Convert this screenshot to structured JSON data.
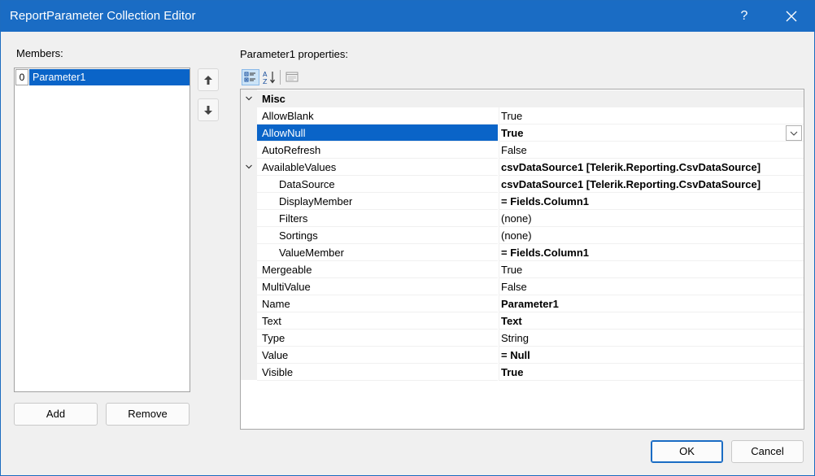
{
  "window": {
    "title": "ReportParameter Collection Editor",
    "help_label": "?"
  },
  "members": {
    "label": "Members:",
    "items": [
      {
        "index": "0",
        "name": "Parameter1"
      }
    ],
    "add_label": "Add",
    "remove_label": "Remove"
  },
  "properties": {
    "label": "Parameter1 properties:",
    "category": "Misc",
    "rows": [
      {
        "name": "AllowBlank",
        "value": "True",
        "bold": false,
        "indent": 0,
        "selected": false
      },
      {
        "name": "AllowNull",
        "value": "True",
        "bold": true,
        "indent": 0,
        "selected": true
      },
      {
        "name": "AutoRefresh",
        "value": "False",
        "bold": false,
        "indent": 0,
        "selected": false
      },
      {
        "name": "AvailableValues",
        "value": "csvDataSource1 [Telerik.Reporting.CsvDataSource]",
        "bold": true,
        "indent": 0,
        "selected": false,
        "expandable": true
      },
      {
        "name": "DataSource",
        "value": "csvDataSource1 [Telerik.Reporting.CsvDataSource]",
        "bold": true,
        "indent": 1,
        "selected": false
      },
      {
        "name": "DisplayMember",
        "value": "= Fields.Column1",
        "bold": true,
        "indent": 1,
        "selected": false
      },
      {
        "name": "Filters",
        "value": "(none)",
        "bold": false,
        "indent": 1,
        "selected": false
      },
      {
        "name": "Sortings",
        "value": "(none)",
        "bold": false,
        "indent": 1,
        "selected": false
      },
      {
        "name": "ValueMember",
        "value": "= Fields.Column1",
        "bold": true,
        "indent": 1,
        "selected": false
      },
      {
        "name": "Mergeable",
        "value": "True",
        "bold": false,
        "indent": 0,
        "selected": false
      },
      {
        "name": "MultiValue",
        "value": "False",
        "bold": false,
        "indent": 0,
        "selected": false
      },
      {
        "name": "Name",
        "value": "Parameter1",
        "bold": true,
        "indent": 0,
        "selected": false
      },
      {
        "name": "Text",
        "value": "Text",
        "bold": true,
        "indent": 0,
        "selected": false
      },
      {
        "name": "Type",
        "value": "String",
        "bold": false,
        "indent": 0,
        "selected": false
      },
      {
        "name": "Value",
        "value": "= Null",
        "bold": true,
        "indent": 0,
        "selected": false
      },
      {
        "name": "Visible",
        "value": "True",
        "bold": true,
        "indent": 0,
        "selected": false
      }
    ]
  },
  "footer": {
    "ok_label": "OK",
    "cancel_label": "Cancel"
  },
  "colors": {
    "title_bar": "#1a6cc4",
    "selection": "#0a64c8",
    "dialog_background": "#f0f0f0"
  },
  "icons": {
    "help": "question-mark",
    "close": "close-x",
    "move_up": "arrow-up",
    "move_down": "arrow-down",
    "categorized": "categorized-view-icon",
    "alphabetical": "alphabetical-sort-icon",
    "property_pages": "property-pages-icon"
  }
}
